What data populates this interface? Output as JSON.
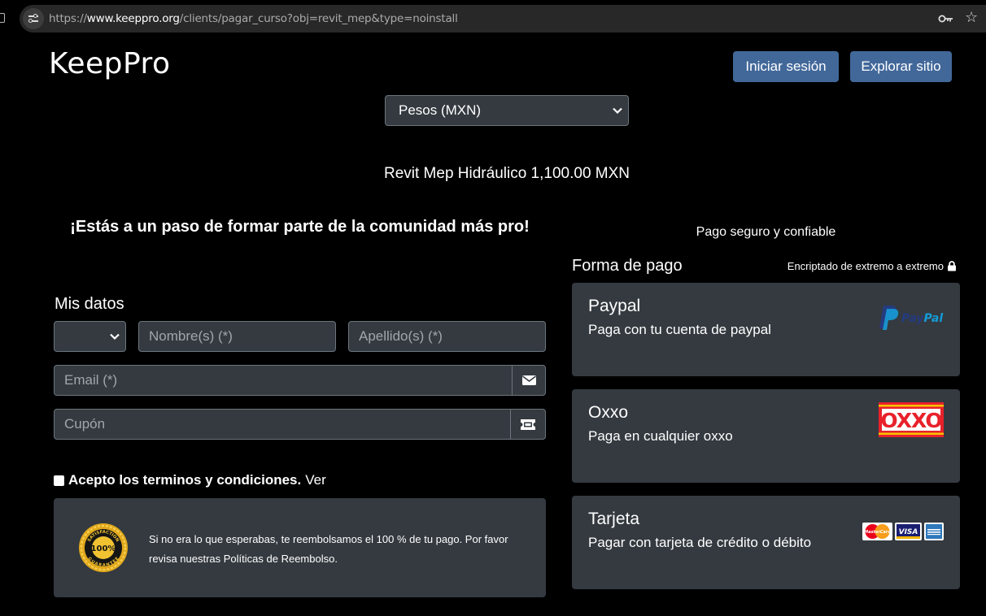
{
  "browser": {
    "url_prefix": "https://",
    "url_domain": "www.keeppro.org",
    "url_path": "/clients/pagar_curso?obj=revit_mep&type=noinstall"
  },
  "header": {
    "logo": "KeepPro",
    "login_label": "Iniciar sesión",
    "explore_label": "Explorar sitio"
  },
  "currency": {
    "selected": "Pesos (MXN)"
  },
  "product": {
    "summary": "Revit Mep Hidráulico 1,100.00 MXN"
  },
  "promo": {
    "headline": "¡Estás a un paso de formar parte de la comunidad más pro!"
  },
  "form": {
    "section_title": "Mis datos",
    "title_select_value": "",
    "name_placeholder": "Nombre(s) (*)",
    "lastname_placeholder": "Apellido(s) (*)",
    "email_placeholder": "Email (*)",
    "coupon_placeholder": "Cupón",
    "terms_label": "Acepto los terminos y condiciones.",
    "terms_link": "Ver",
    "refund_text": "Si no era lo que esperabas, te reembolsamos el 100 % de tu pago. Por favor revisa nuestras Políticas de Reembolso.",
    "seal_text_top": "SATISFACTION",
    "seal_text_center": "100%",
    "seal_text_bottom": "GUARANTEE"
  },
  "payment": {
    "secure_label": "Pago seguro y confiable",
    "title": "Forma de pago",
    "encrypted_label": "Encriptado de extremo a extremo",
    "methods": [
      {
        "title": "Paypal",
        "desc": "Paga con tu cuenta de paypal",
        "logo_text": "PayPal"
      },
      {
        "title": "Oxxo",
        "desc": "Paga en cualquier oxxo",
        "logo_text": "OXXO"
      },
      {
        "title": "Tarjeta",
        "desc": "Pagar con tarjeta de crédito o débito",
        "logo_text_mc": "MasterCard",
        "logo_text_visa": "VISA"
      }
    ]
  },
  "colors": {
    "accent_button": "#42689a",
    "panel": "#343a40",
    "background": "#000000",
    "oxxo_red": "#e8212b",
    "oxxo_yellow": "#f8c300"
  }
}
